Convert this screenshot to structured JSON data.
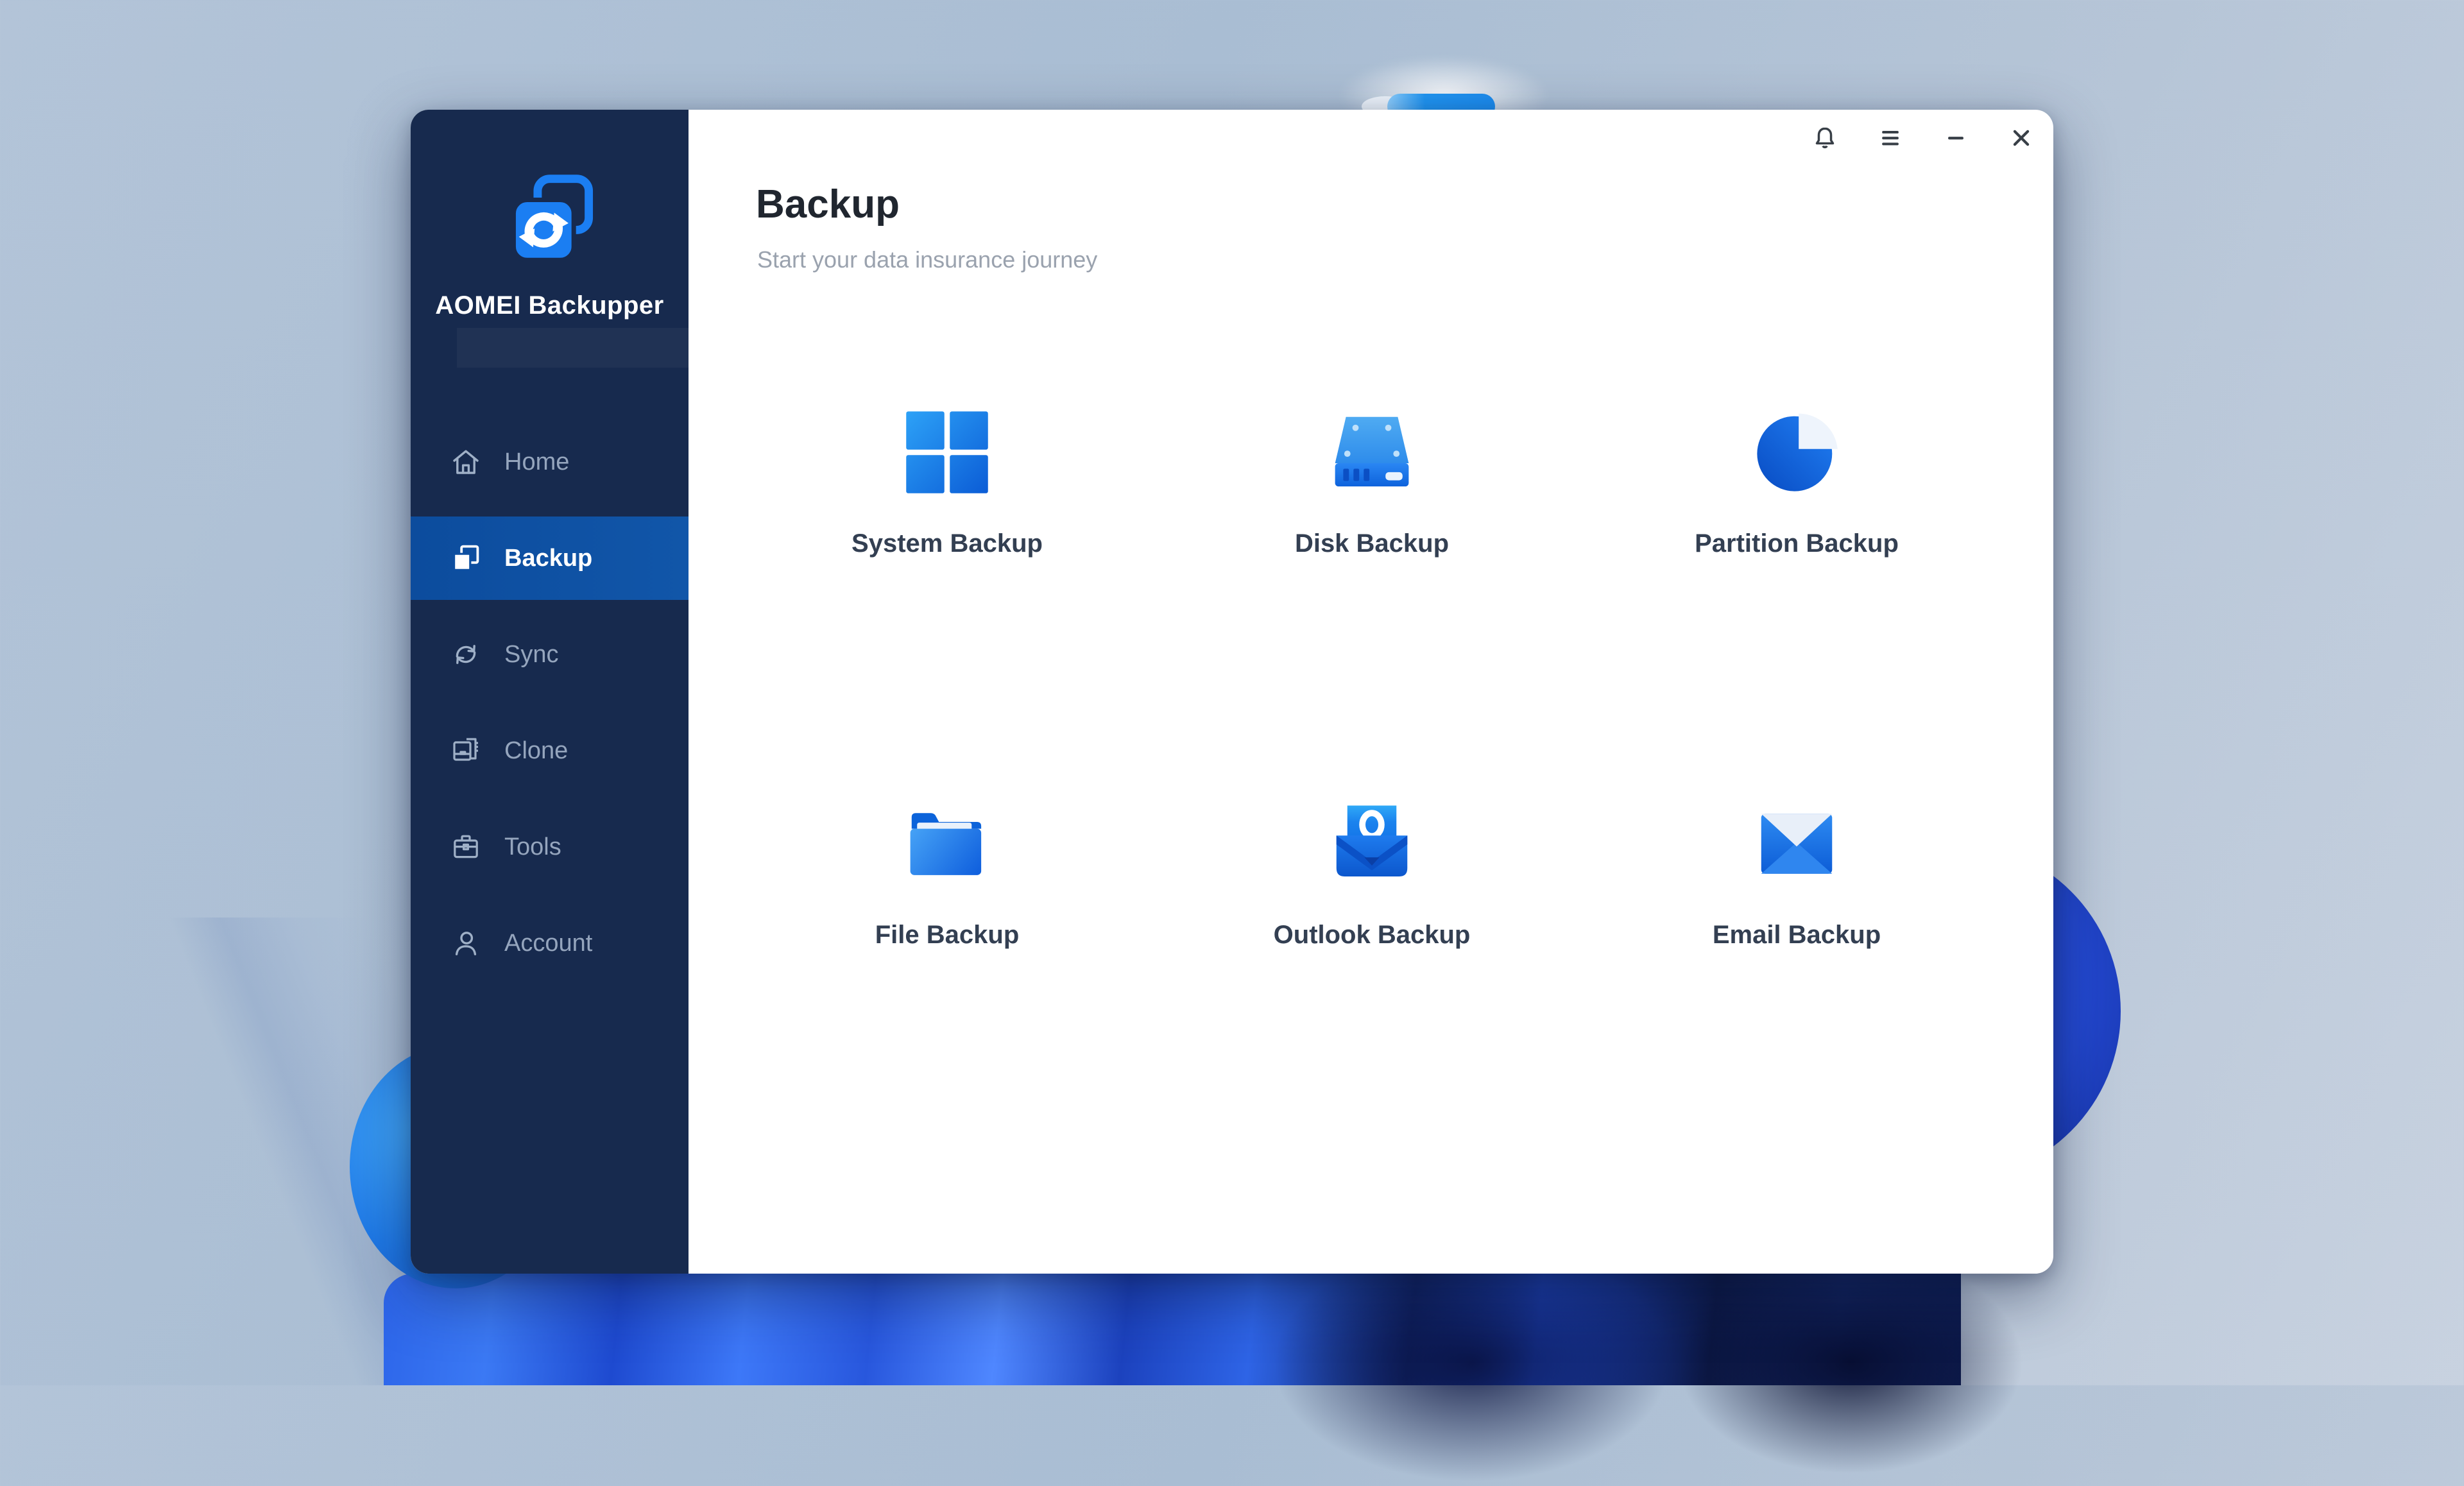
{
  "desktop": {
    "wallpaper": "Windows 11 bloom"
  },
  "window": {
    "app": "AOMEI Backupper",
    "titlebar": {
      "buttons": [
        {
          "label": "notifications",
          "icon": "bell-icon"
        },
        {
          "label": "menu",
          "icon": "hamburger-icon"
        },
        {
          "label": "minimize",
          "icon": "minimize-icon"
        },
        {
          "label": "close",
          "icon": "close-icon"
        }
      ]
    },
    "sidebar": {
      "brand": {
        "name": "AOMEI Backupper",
        "icon": "aomei-sync-logo"
      },
      "items": [
        {
          "label": "Home",
          "icon": "home-icon",
          "selected": false
        },
        {
          "label": "Backup",
          "icon": "backup-icon",
          "selected": true
        },
        {
          "label": "Sync",
          "icon": "sync-icon",
          "selected": false
        },
        {
          "label": "Clone",
          "icon": "clone-icon",
          "selected": false
        },
        {
          "label": "Tools",
          "icon": "toolbox-icon",
          "selected": false
        },
        {
          "label": "Account",
          "icon": "person-icon",
          "selected": false
        }
      ]
    },
    "page": {
      "title": "Backup",
      "subtitle": "Start your data insurance journey",
      "tiles": [
        {
          "label": "System Backup",
          "icon": "windows-grid-icon"
        },
        {
          "label": "Disk Backup",
          "icon": "hard-disk-icon"
        },
        {
          "label": "Partition Backup",
          "icon": "pie-partition-icon"
        },
        {
          "label": "File Backup",
          "icon": "folder-icon"
        },
        {
          "label": "Outlook Backup",
          "icon": "outlook-envelope-icon"
        },
        {
          "label": "Email Backup",
          "icon": "email-envelope-icon"
        }
      ]
    }
  },
  "colors": {
    "sidebar_bg": "#172a4e",
    "sidebar_selected_bg": "#0d4fa1",
    "accent_blue": "#1b7ef2",
    "content_bg": "#ffffff",
    "title_text": "#20262f",
    "subtitle_text": "#9aa2ae",
    "sidebar_text": "#95a5bd",
    "tile_label_text": "#333f52"
  }
}
